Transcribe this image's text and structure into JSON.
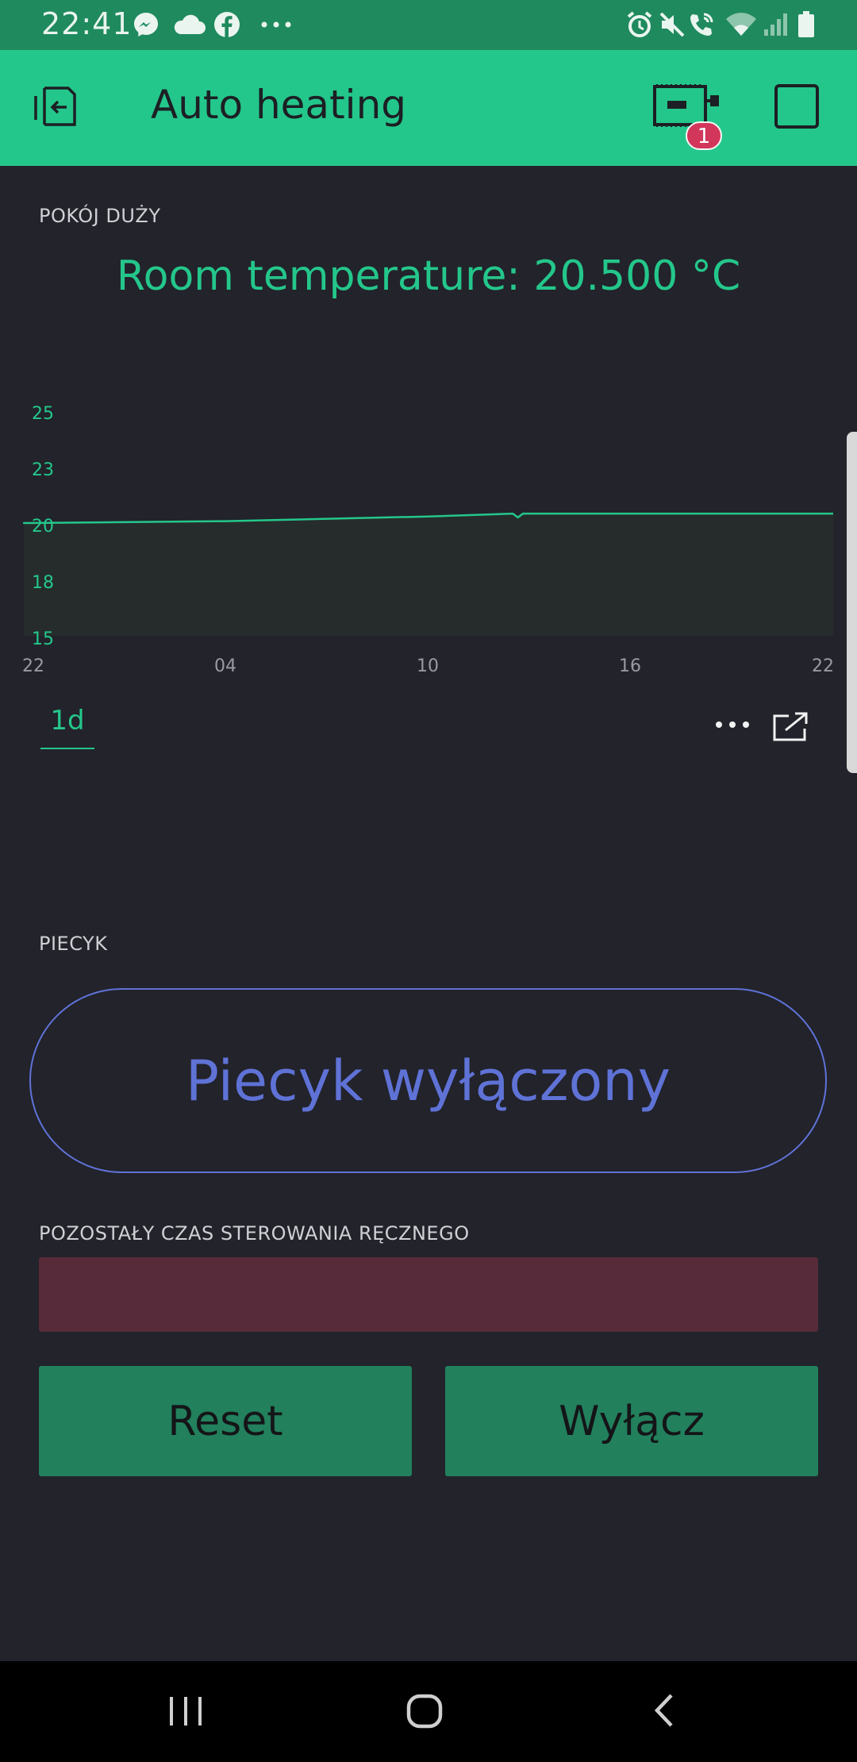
{
  "status_bar": {
    "time": "22:41",
    "left_icons": [
      "messenger-icon",
      "cloud-icon",
      "facebook-icon",
      "more-notifications-icon"
    ],
    "right_icons": [
      "alarm-icon",
      "mute-icon",
      "wifi-call-icon",
      "wifi-icon",
      "signal-icon",
      "battery-icon"
    ]
  },
  "app_bar": {
    "title": "Auto heating",
    "badge_count": "1",
    "accent": "#24c78b"
  },
  "room_widget": {
    "label": "POKÓJ DUŻY",
    "value_text": "Room temperature: 20.500 °C"
  },
  "chart_data": {
    "type": "area",
    "x_ticks": [
      "22",
      "04",
      "10",
      "16",
      "22"
    ],
    "y_ticks": [
      25,
      23,
      20,
      18,
      15
    ],
    "ylim": [
      15,
      25
    ],
    "series": [
      {
        "color": "#24c78b",
        "x_hours": [
          0,
          6,
          12,
          14.5,
          14.65,
          14.8,
          19,
          24
        ],
        "values": [
          20.0,
          20.1,
          20.35,
          20.5,
          20.3,
          20.5,
          20.5,
          20.5
        ]
      }
    ],
    "grid": false,
    "period_tab": "1d"
  },
  "heater_widget": {
    "label": "PIECYK",
    "button_text": "Piecyk wyłączony",
    "color": "#5f72d6"
  },
  "manual_widget": {
    "label": "POZOSTAŁY CZAS STEROWANIA RĘCZNEGO",
    "bar_color": "#572b39"
  },
  "buttons": {
    "reset": "Reset",
    "off": "Wyłącz"
  },
  "nav_bar": {
    "icons": [
      "recent-apps-icon",
      "home-icon",
      "back-icon"
    ]
  }
}
